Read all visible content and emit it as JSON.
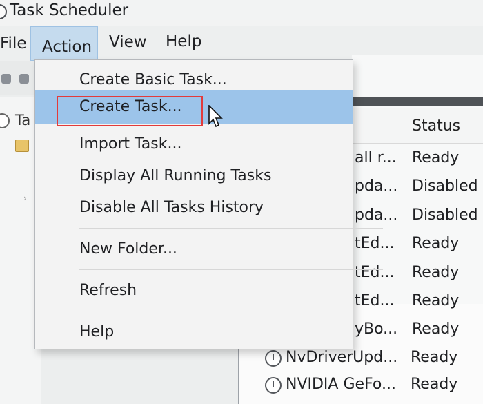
{
  "window": {
    "title": "Task Scheduler"
  },
  "menubar": {
    "file": "File",
    "action": "Action",
    "view": "View",
    "help": "Help"
  },
  "tree": {
    "root_label": "Ta"
  },
  "list": {
    "status_header": "Status",
    "rows": [
      {
        "name": "all r...",
        "status": "Ready"
      },
      {
        "name": "pda...",
        "status": "Disabled"
      },
      {
        "name": "pda...",
        "status": "Disabled"
      },
      {
        "name": "tEd...",
        "status": "Ready"
      },
      {
        "name": "tEd...",
        "status": "Ready"
      },
      {
        "name": "tEd...",
        "status": "Ready"
      },
      {
        "name": "yBo...",
        "status": "Ready"
      },
      {
        "name": "NvDriverUpd...",
        "status": "Ready"
      },
      {
        "name": "NVIDIA GeFo...",
        "status": "Ready"
      }
    ]
  },
  "action_menu": {
    "items": [
      "Create Basic Task...",
      "Create Task...",
      "Import Task...",
      "Display All Running Tasks",
      "Disable All Tasks History",
      "New Folder...",
      "Refresh",
      "Help"
    ],
    "hovered_index": 1
  },
  "colors": {
    "hover": "#9cc4ea",
    "highlight_outline": "#e23b3b",
    "active_menu": "#c5dbee"
  },
  "icons": [
    "clock-icon",
    "folder-icon",
    "cursor-icon",
    "chevron-right-icon"
  ]
}
